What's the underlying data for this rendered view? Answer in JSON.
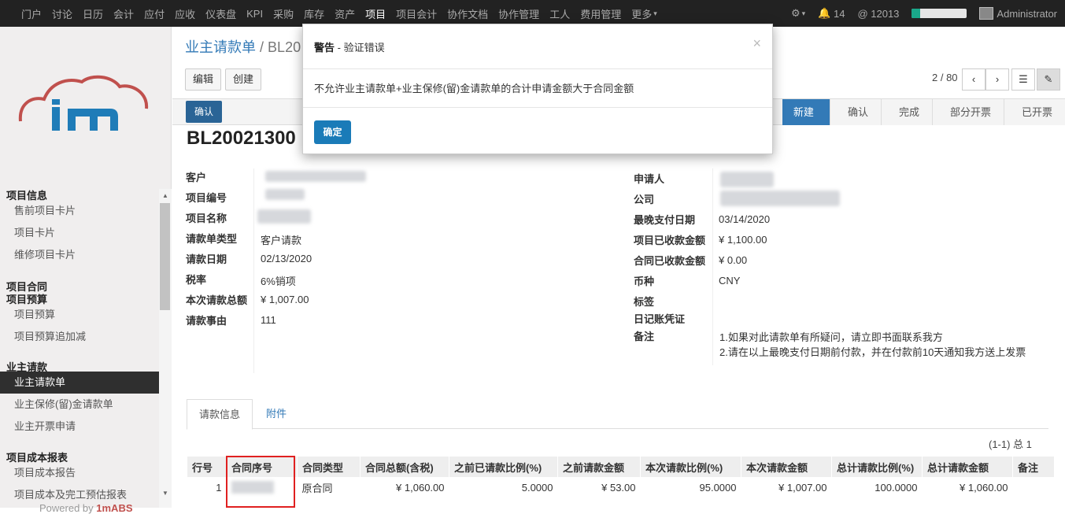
{
  "top_menu": {
    "items": [
      "门户",
      "讨论",
      "日历",
      "会计",
      "应付",
      "应收",
      "仪表盘",
      "KPI",
      "采购",
      "库存",
      "资产",
      "项目",
      "项目会计",
      "协作文档",
      "协作管理",
      "工人",
      "费用管理",
      "更多"
    ],
    "active": "项目",
    "notifications": "14",
    "mentions": "12013",
    "storage_progress": 0.15,
    "user": "Administrator"
  },
  "sidebar": {
    "groups": [
      {
        "title": "项目信息",
        "items": [
          "售前项目卡片",
          "项目卡片",
          "维修项目卡片"
        ]
      },
      {
        "title": "项目合同",
        "items": []
      },
      {
        "title": "项目预算",
        "items": [
          "项目预算",
          "项目预算追加减"
        ]
      },
      {
        "title": "业主请款",
        "items": [
          "业主请款单",
          "业主保修(留)金请款单",
          "业主开票申请"
        ]
      },
      {
        "title": "项目成本报表",
        "items": [
          "项目成本报告",
          "项目成本及完工预估报表"
        ]
      }
    ],
    "active_item": "业主请款单",
    "powered_prefix": "Powered by ",
    "powered_brand": "1mABS"
  },
  "breadcrumb": {
    "parent": "业主请款单",
    "sep": "/",
    "current": "BL20"
  },
  "buttons": {
    "edit": "编辑",
    "create": "创建",
    "confirm": "确认"
  },
  "pager": {
    "text": "2 / 80",
    "prev": "‹",
    "next": "›"
  },
  "stages": [
    "新建",
    "确认",
    "完成",
    "部分开票",
    "已开票"
  ],
  "active_stage": "新建",
  "record": {
    "title": "BL20021300",
    "left_fields": [
      {
        "label": "客户",
        "value": ""
      },
      {
        "label": "项目编号",
        "value": ""
      },
      {
        "label": "项目名称",
        "value": ""
      },
      {
        "label": "请款单类型",
        "value": "客户请款"
      },
      {
        "label": "请款日期",
        "value": "02/13/2020"
      },
      {
        "label": "税率",
        "value": "6%销项"
      },
      {
        "label": "本次请款总额",
        "value": "¥ 1,007.00"
      },
      {
        "label": "请款事由",
        "value": "111"
      }
    ],
    "right_fields": [
      {
        "label": "申请人",
        "value": ""
      },
      {
        "label": "公司",
        "value": ""
      },
      {
        "label": "最晚支付日期",
        "value": "03/14/2020"
      },
      {
        "label": "项目已收款金额",
        "value": "¥ 1,100.00"
      },
      {
        "label": "合同已收款金额",
        "value": "¥ 0.00"
      },
      {
        "label": "币种",
        "value": "CNY"
      },
      {
        "label": "标签",
        "value": ""
      },
      {
        "label": "日记账凭证",
        "value": ""
      },
      {
        "label": "备注",
        "value": ""
      }
    ],
    "notes": [
      "1.如果对此请款单有所疑问，请立即书面联系我方",
      "2.请在以上最晚支付日期前付款，并在付款前10天通知我方送上发票"
    ]
  },
  "tabs": [
    "请款信息",
    "附件"
  ],
  "table": {
    "count": "(1-1) 总 1",
    "headers": [
      "行号",
      "合同序号",
      "合同类型",
      "合同总额(含税)",
      "之前已请款比例(%)",
      "之前请款金额",
      "本次请款比例(%)",
      "本次请款金额",
      "总计请款比例(%)",
      "总计请款金额",
      "备注"
    ],
    "rows": [
      [
        "1",
        "",
        "原合同",
        "¥ 1,060.00",
        "5.0000",
        "¥ 53.00",
        "95.0000",
        "¥ 1,007.00",
        "100.0000",
        "¥ 1,060.00",
        ""
      ]
    ]
  },
  "modal": {
    "title_bold": "警告",
    "title_rest": " - 验证错误",
    "close": "×",
    "message": "不允许业主请款单+业主保修(留)金请款单的合计申请金额大于合同金额",
    "ok": "确定"
  },
  "colors": {
    "primary": "#337ab7",
    "highlight": "#e02020",
    "brand_red": "#c0504d",
    "brand_blue": "#1f7cb8"
  }
}
